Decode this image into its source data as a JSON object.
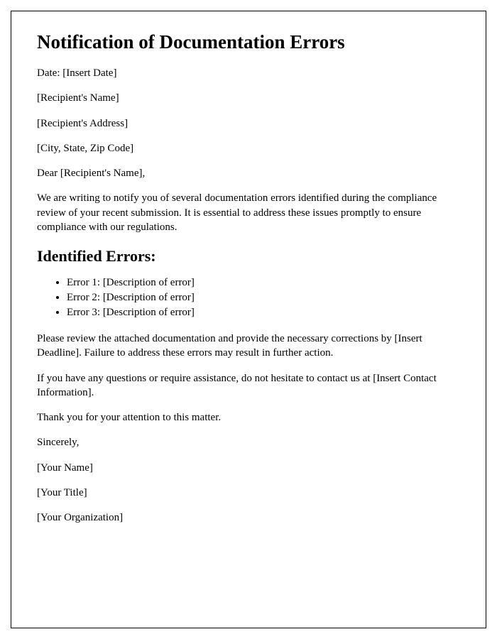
{
  "title": "Notification of Documentation Errors",
  "date_line": "Date: [Insert Date]",
  "recipient_name": "[Recipient's Name]",
  "recipient_address": "[Recipient's Address]",
  "recipient_city": "[City, State, Zip Code]",
  "salutation": "Dear [Recipient's Name],",
  "intro_paragraph": "We are writing to notify you of several documentation errors identified during the compliance review of your recent submission. It is essential to address these issues promptly to ensure compliance with our regulations.",
  "errors_heading": "Identified Errors:",
  "errors": [
    "Error 1: [Description of error]",
    "Error 2: [Description of error]",
    "Error 3: [Description of error]"
  ],
  "review_paragraph": "Please review the attached documentation and provide the necessary corrections by [Insert Deadline]. Failure to address these errors may result in further action.",
  "contact_paragraph": "If you have any questions or require assistance, do not hesitate to contact us at [Insert Contact Information].",
  "thanks": "Thank you for your attention to this matter.",
  "closing": "Sincerely,",
  "sender_name": "[Your Name]",
  "sender_title": "[Your Title]",
  "sender_org": "[Your Organization]"
}
